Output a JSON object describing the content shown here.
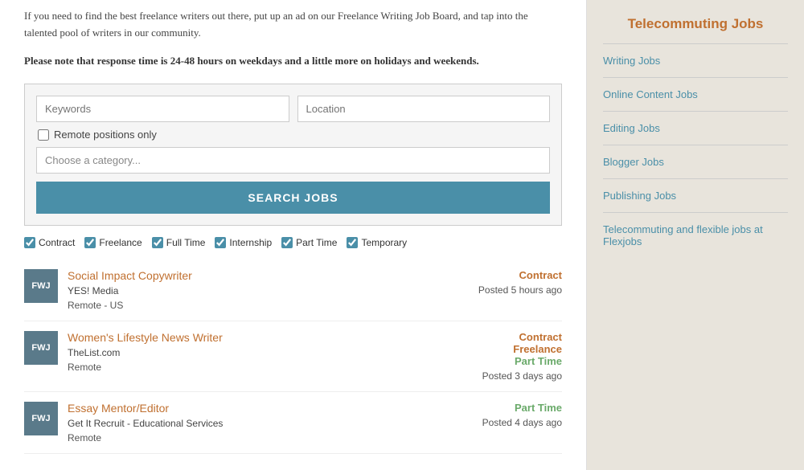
{
  "intro": {
    "text1": "If you need to find the best freelance writers out there, put up an ad on our Freelance Writing Job Board, and tap into the talented pool of writers in our community.",
    "text2": "Please note that response time is 24-48 hours on weekdays and a little more on holidays and weekends."
  },
  "search": {
    "keywords_placeholder": "Keywords",
    "location_placeholder": "Location",
    "remote_label": "Remote positions only",
    "category_placeholder": "Choose a category...",
    "button_label": "SEARCH JOBS"
  },
  "filters": [
    {
      "label": "Contract",
      "checked": true
    },
    {
      "label": "Freelance",
      "checked": true
    },
    {
      "label": "Full Time",
      "checked": true
    },
    {
      "label": "Internship",
      "checked": true
    },
    {
      "label": "Part Time",
      "checked": true
    },
    {
      "label": "Temporary",
      "checked": true
    }
  ],
  "jobs": [
    {
      "logo": "FWJ",
      "title": "Social Impact Copywriter",
      "company": "YES! Media",
      "location": "Remote - US",
      "types": [
        "Contract"
      ],
      "posted": "Posted 5 hours ago"
    },
    {
      "logo": "FWJ",
      "title": "Women's Lifestyle News Writer",
      "company": "TheList.com",
      "location": "Remote",
      "types": [
        "Contract",
        "Freelance",
        "Part Time"
      ],
      "posted": "Posted 3 days ago"
    },
    {
      "logo": "FWJ",
      "title": "Essay Mentor/Editor",
      "company": "Get It Recruit - Educational Services",
      "location": "Remote",
      "types": [
        "Part Time"
      ],
      "posted": "Posted 4 days ago"
    }
  ],
  "sidebar": {
    "title": "Telecommuting Jobs",
    "links": [
      "Writing Jobs",
      "Online Content Jobs",
      "Editing Jobs",
      "Blogger Jobs",
      "Publishing Jobs",
      "Telecommuting and flexible jobs at Flexjobs"
    ]
  }
}
